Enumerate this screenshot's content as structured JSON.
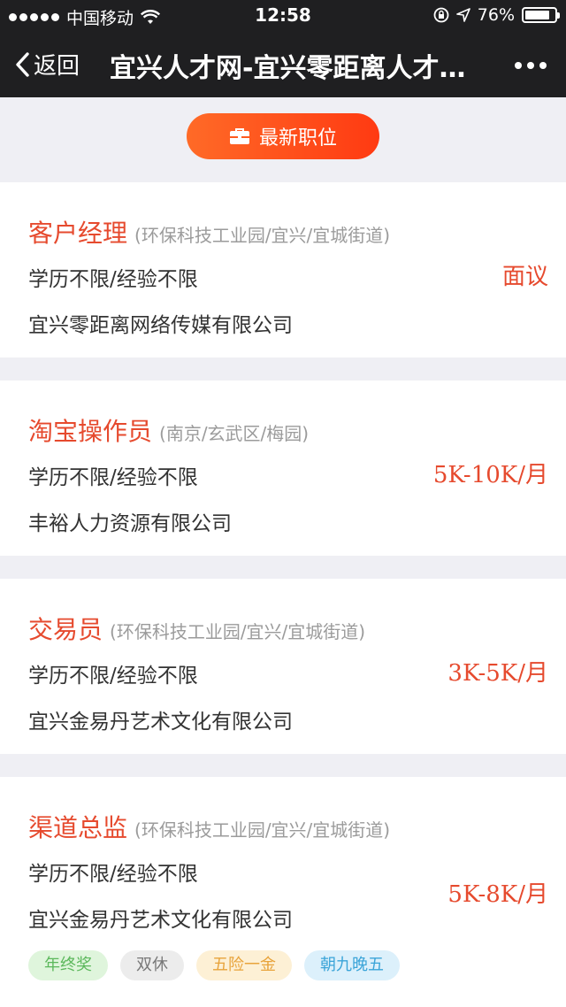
{
  "status_bar": {
    "carrier": "中国移动",
    "time": "12:58",
    "battery": "76%"
  },
  "nav": {
    "back_label": "返回",
    "title": "宜兴人才网-宜兴零距离人才…"
  },
  "latest_button": {
    "label": "最新职位"
  },
  "jobs": [
    {
      "title": "客户经理",
      "location": "(环保科技工业园/宜兴/宜城街道)",
      "requirement": "学历不限/经验不限",
      "company": "宜兴零距离网络传媒有限公司",
      "salary": "面议"
    },
    {
      "title": "淘宝操作员",
      "location": "(南京/玄武区/梅园)",
      "requirement": "学历不限/经验不限",
      "company": "丰裕人力资源有限公司",
      "salary": "5K-10K/月"
    },
    {
      "title": "交易员",
      "location": "(环保科技工业园/宜兴/宜城街道)",
      "requirement": "学历不限/经验不限",
      "company": "宜兴金易丹艺术文化有限公司",
      "salary": "3K-5K/月"
    },
    {
      "title": "渠道总监",
      "location": "(环保科技工业园/宜兴/宜城街道)",
      "requirement": "学历不限/经验不限",
      "company": "宜兴金易丹艺术文化有限公司",
      "salary": "5K-8K/月",
      "tags": [
        {
          "label": "年终奖",
          "bg": "#dff5dc",
          "color": "#5cb85c"
        },
        {
          "label": "双休",
          "bg": "#ececec",
          "color": "#777777"
        },
        {
          "label": "五险一金",
          "bg": "#fdf0d5",
          "color": "#e8a33b"
        },
        {
          "label": "朝九晚五",
          "bg": "#dcf0fb",
          "color": "#3aa4d8"
        }
      ]
    }
  ],
  "colors": {
    "accent": "#e64a2e",
    "nav_bg": "#1f1f21",
    "page_bg": "#efeff4"
  }
}
